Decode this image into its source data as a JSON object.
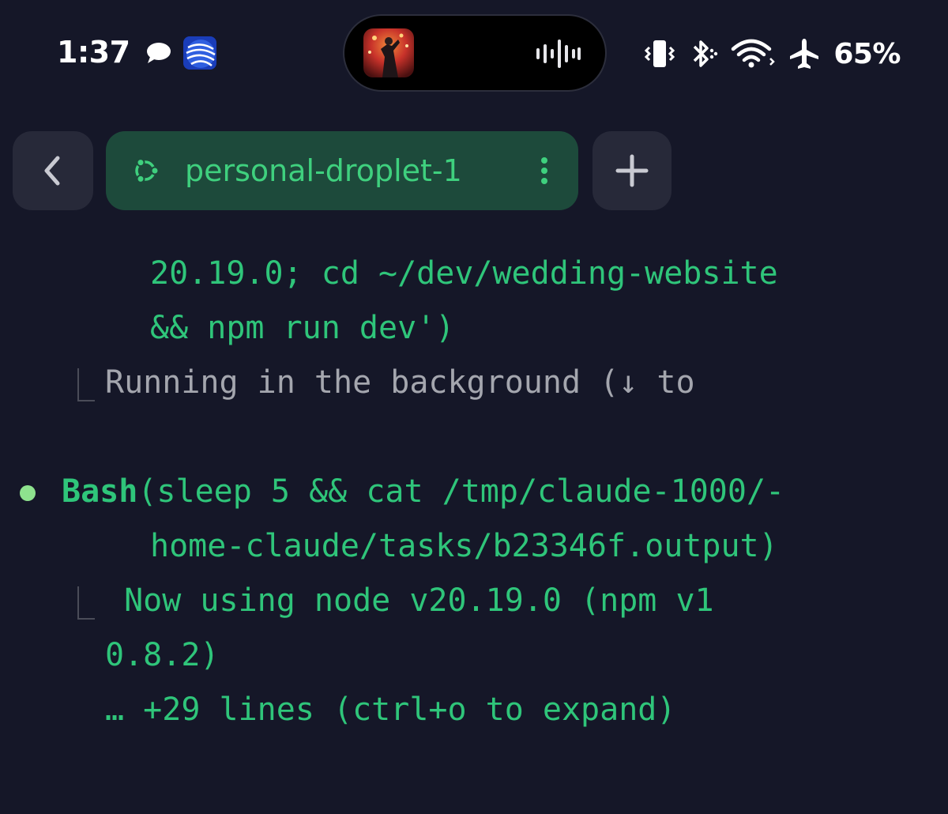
{
  "status_bar": {
    "time": "1:37",
    "battery": "65%",
    "icons": [
      "messages-icon",
      "united-airlines-app-icon",
      "now-playing-artwork",
      "audio-waveform-icon",
      "vibrate-icon",
      "bluetooth-icon",
      "wifi-icon",
      "airplane-mode-icon"
    ]
  },
  "tabbar": {
    "back_icon": "chevron-left-icon",
    "active_tab": {
      "icon": "ubuntu-icon",
      "label": "personal-droplet-1",
      "menu_icon": "vertical-ellipsis-icon"
    },
    "add_icon": "plus-icon"
  },
  "terminal": {
    "lines": [
      "20.19.0; cd ~/dev/wedding-website",
      "&& npm run dev')",
      "Running in the background (↓ to",
      "Bash",
      "(sleep 5 && cat /tmp/claude-1000/-",
      "home-claude/tasks/b23346f.output)",
      " Now using node v20.19.0 (npm v1",
      "0.8.2)",
      "… +29 lines (ctrl+o to expand)"
    ]
  },
  "colors": {
    "background": "#151728",
    "terminal_green": "#2fc57a",
    "terminal_gray": "#a4a6ae",
    "tab_active_bg": "#1d4a3b",
    "button_bg": "#272939",
    "bullet_dot": "#8ee28e"
  }
}
